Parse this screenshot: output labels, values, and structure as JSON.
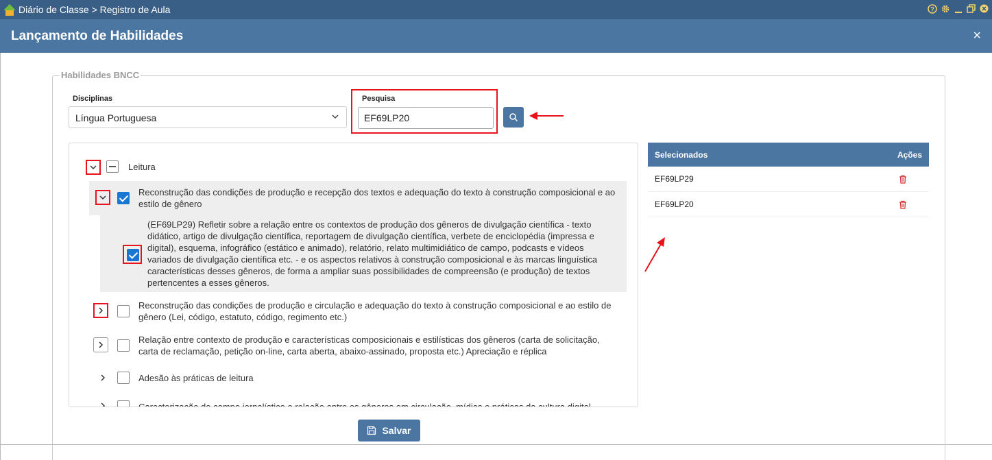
{
  "window": {
    "breadcrumb": "Diário de Classe > Registro de Aula",
    "controls": [
      "help-icon",
      "gear-icon",
      "minimize-icon",
      "restore-icon",
      "close-icon"
    ]
  },
  "dialog": {
    "title": "Lançamento de Habilidades",
    "close_label": "×"
  },
  "fieldset": {
    "legend": "Habilidades BNCC"
  },
  "filters": {
    "disciplinas_label": "Disciplinas",
    "disciplina_value": "Língua Portuguesa",
    "pesquisa_label": "Pesquisa",
    "pesquisa_value": "EF69LP20"
  },
  "tree": {
    "root": {
      "label": "Leitura",
      "state": "partial",
      "expanded": true
    },
    "items": [
      {
        "label": "Reconstrução das condições de produção e recepção dos textos e adequação do texto à construção composicional e ao estilo de gênero",
        "checked": true,
        "expanded": true,
        "children": [
          {
            "label": "(EF69LP29) Refletir sobre a relação entre os contextos de produção dos gêneros de divulgação científica - texto didático, artigo de divulgação científica, reportagem de divulgação científica, verbete de enciclopédia (impressa e digital), esquema, infográfico (estático e animado), relatório, relato multimidiático de campo, podcasts e vídeos variados de divulgação científica etc. - e os aspectos relativos à construção composicional e às marcas linguística características desses gêneros, de forma a ampliar suas possibilidades de compreensão (e produção) de textos pertencentes a esses gêneros.",
            "checked": true
          }
        ]
      },
      {
        "label": "Reconstrução das condições de produção e circulação e adequação do texto à construção composicional e ao estilo de gênero (Lei, código, estatuto, código, regimento etc.)",
        "checked": false,
        "expanded": false
      },
      {
        "label": "Relação entre contexto de produção e características composicionais e estilísticas dos gêneros (carta de solicitação, carta de reclamação, petição on-line, carta aberta, abaixo-assinado, proposta etc.) Apreciação e réplica",
        "checked": false,
        "expanded": false
      },
      {
        "label": "Adesão às práticas de leitura",
        "checked": false,
        "expanded": false
      },
      {
        "label": "Caracterização do campo jornalístico e relação entre os gêneros em circulação, mídias e práticas da cultura digital",
        "checked": false,
        "expanded": false
      }
    ]
  },
  "selected": {
    "header_selected": "Selecionados",
    "header_actions": "Ações",
    "rows": [
      "EF69LP29",
      "EF69LP20"
    ]
  },
  "actions": {
    "save_label": "Salvar"
  },
  "colors": {
    "titlebar": "#3a5f86",
    "header": "#4b76a1",
    "accent": "#1976d2",
    "highlight": "#e8131c",
    "trash": "#d32f2f"
  }
}
